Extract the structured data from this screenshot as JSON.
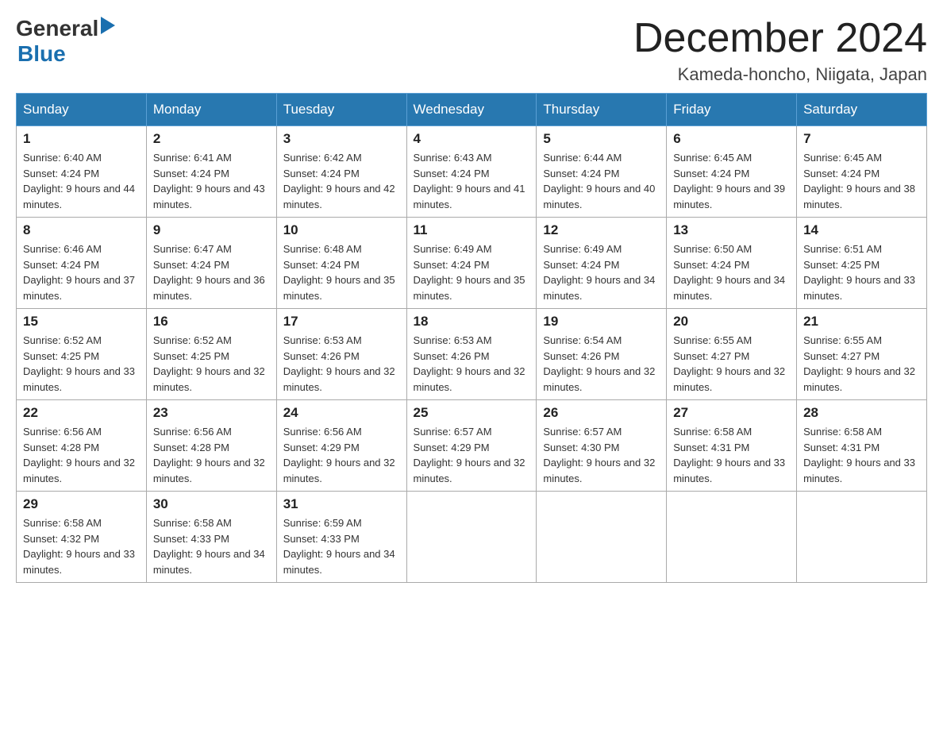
{
  "header": {
    "logo_general": "General",
    "logo_blue": "Blue",
    "title": "December 2024",
    "location": "Kameda-honcho, Niigata, Japan"
  },
  "days_of_week": [
    "Sunday",
    "Monday",
    "Tuesday",
    "Wednesday",
    "Thursday",
    "Friday",
    "Saturday"
  ],
  "weeks": [
    [
      {
        "day": "1",
        "sunrise": "6:40 AM",
        "sunset": "4:24 PM",
        "daylight": "9 hours and 44 minutes."
      },
      {
        "day": "2",
        "sunrise": "6:41 AM",
        "sunset": "4:24 PM",
        "daylight": "9 hours and 43 minutes."
      },
      {
        "day": "3",
        "sunrise": "6:42 AM",
        "sunset": "4:24 PM",
        "daylight": "9 hours and 42 minutes."
      },
      {
        "day": "4",
        "sunrise": "6:43 AM",
        "sunset": "4:24 PM",
        "daylight": "9 hours and 41 minutes."
      },
      {
        "day": "5",
        "sunrise": "6:44 AM",
        "sunset": "4:24 PM",
        "daylight": "9 hours and 40 minutes."
      },
      {
        "day": "6",
        "sunrise": "6:45 AM",
        "sunset": "4:24 PM",
        "daylight": "9 hours and 39 minutes."
      },
      {
        "day": "7",
        "sunrise": "6:45 AM",
        "sunset": "4:24 PM",
        "daylight": "9 hours and 38 minutes."
      }
    ],
    [
      {
        "day": "8",
        "sunrise": "6:46 AM",
        "sunset": "4:24 PM",
        "daylight": "9 hours and 37 minutes."
      },
      {
        "day": "9",
        "sunrise": "6:47 AM",
        "sunset": "4:24 PM",
        "daylight": "9 hours and 36 minutes."
      },
      {
        "day": "10",
        "sunrise": "6:48 AM",
        "sunset": "4:24 PM",
        "daylight": "9 hours and 35 minutes."
      },
      {
        "day": "11",
        "sunrise": "6:49 AM",
        "sunset": "4:24 PM",
        "daylight": "9 hours and 35 minutes."
      },
      {
        "day": "12",
        "sunrise": "6:49 AM",
        "sunset": "4:24 PM",
        "daylight": "9 hours and 34 minutes."
      },
      {
        "day": "13",
        "sunrise": "6:50 AM",
        "sunset": "4:24 PM",
        "daylight": "9 hours and 34 minutes."
      },
      {
        "day": "14",
        "sunrise": "6:51 AM",
        "sunset": "4:25 PM",
        "daylight": "9 hours and 33 minutes."
      }
    ],
    [
      {
        "day": "15",
        "sunrise": "6:52 AM",
        "sunset": "4:25 PM",
        "daylight": "9 hours and 33 minutes."
      },
      {
        "day": "16",
        "sunrise": "6:52 AM",
        "sunset": "4:25 PM",
        "daylight": "9 hours and 32 minutes."
      },
      {
        "day": "17",
        "sunrise": "6:53 AM",
        "sunset": "4:26 PM",
        "daylight": "9 hours and 32 minutes."
      },
      {
        "day": "18",
        "sunrise": "6:53 AM",
        "sunset": "4:26 PM",
        "daylight": "9 hours and 32 minutes."
      },
      {
        "day": "19",
        "sunrise": "6:54 AM",
        "sunset": "4:26 PM",
        "daylight": "9 hours and 32 minutes."
      },
      {
        "day": "20",
        "sunrise": "6:55 AM",
        "sunset": "4:27 PM",
        "daylight": "9 hours and 32 minutes."
      },
      {
        "day": "21",
        "sunrise": "6:55 AM",
        "sunset": "4:27 PM",
        "daylight": "9 hours and 32 minutes."
      }
    ],
    [
      {
        "day": "22",
        "sunrise": "6:56 AM",
        "sunset": "4:28 PM",
        "daylight": "9 hours and 32 minutes."
      },
      {
        "day": "23",
        "sunrise": "6:56 AM",
        "sunset": "4:28 PM",
        "daylight": "9 hours and 32 minutes."
      },
      {
        "day": "24",
        "sunrise": "6:56 AM",
        "sunset": "4:29 PM",
        "daylight": "9 hours and 32 minutes."
      },
      {
        "day": "25",
        "sunrise": "6:57 AM",
        "sunset": "4:29 PM",
        "daylight": "9 hours and 32 minutes."
      },
      {
        "day": "26",
        "sunrise": "6:57 AM",
        "sunset": "4:30 PM",
        "daylight": "9 hours and 32 minutes."
      },
      {
        "day": "27",
        "sunrise": "6:58 AM",
        "sunset": "4:31 PM",
        "daylight": "9 hours and 33 minutes."
      },
      {
        "day": "28",
        "sunrise": "6:58 AM",
        "sunset": "4:31 PM",
        "daylight": "9 hours and 33 minutes."
      }
    ],
    [
      {
        "day": "29",
        "sunrise": "6:58 AM",
        "sunset": "4:32 PM",
        "daylight": "9 hours and 33 minutes."
      },
      {
        "day": "30",
        "sunrise": "6:58 AM",
        "sunset": "4:33 PM",
        "daylight": "9 hours and 34 minutes."
      },
      {
        "day": "31",
        "sunrise": "6:59 AM",
        "sunset": "4:33 PM",
        "daylight": "9 hours and 34 minutes."
      },
      null,
      null,
      null,
      null
    ]
  ],
  "labels": {
    "sunrise": "Sunrise:",
    "sunset": "Sunset:",
    "daylight": "Daylight:"
  }
}
